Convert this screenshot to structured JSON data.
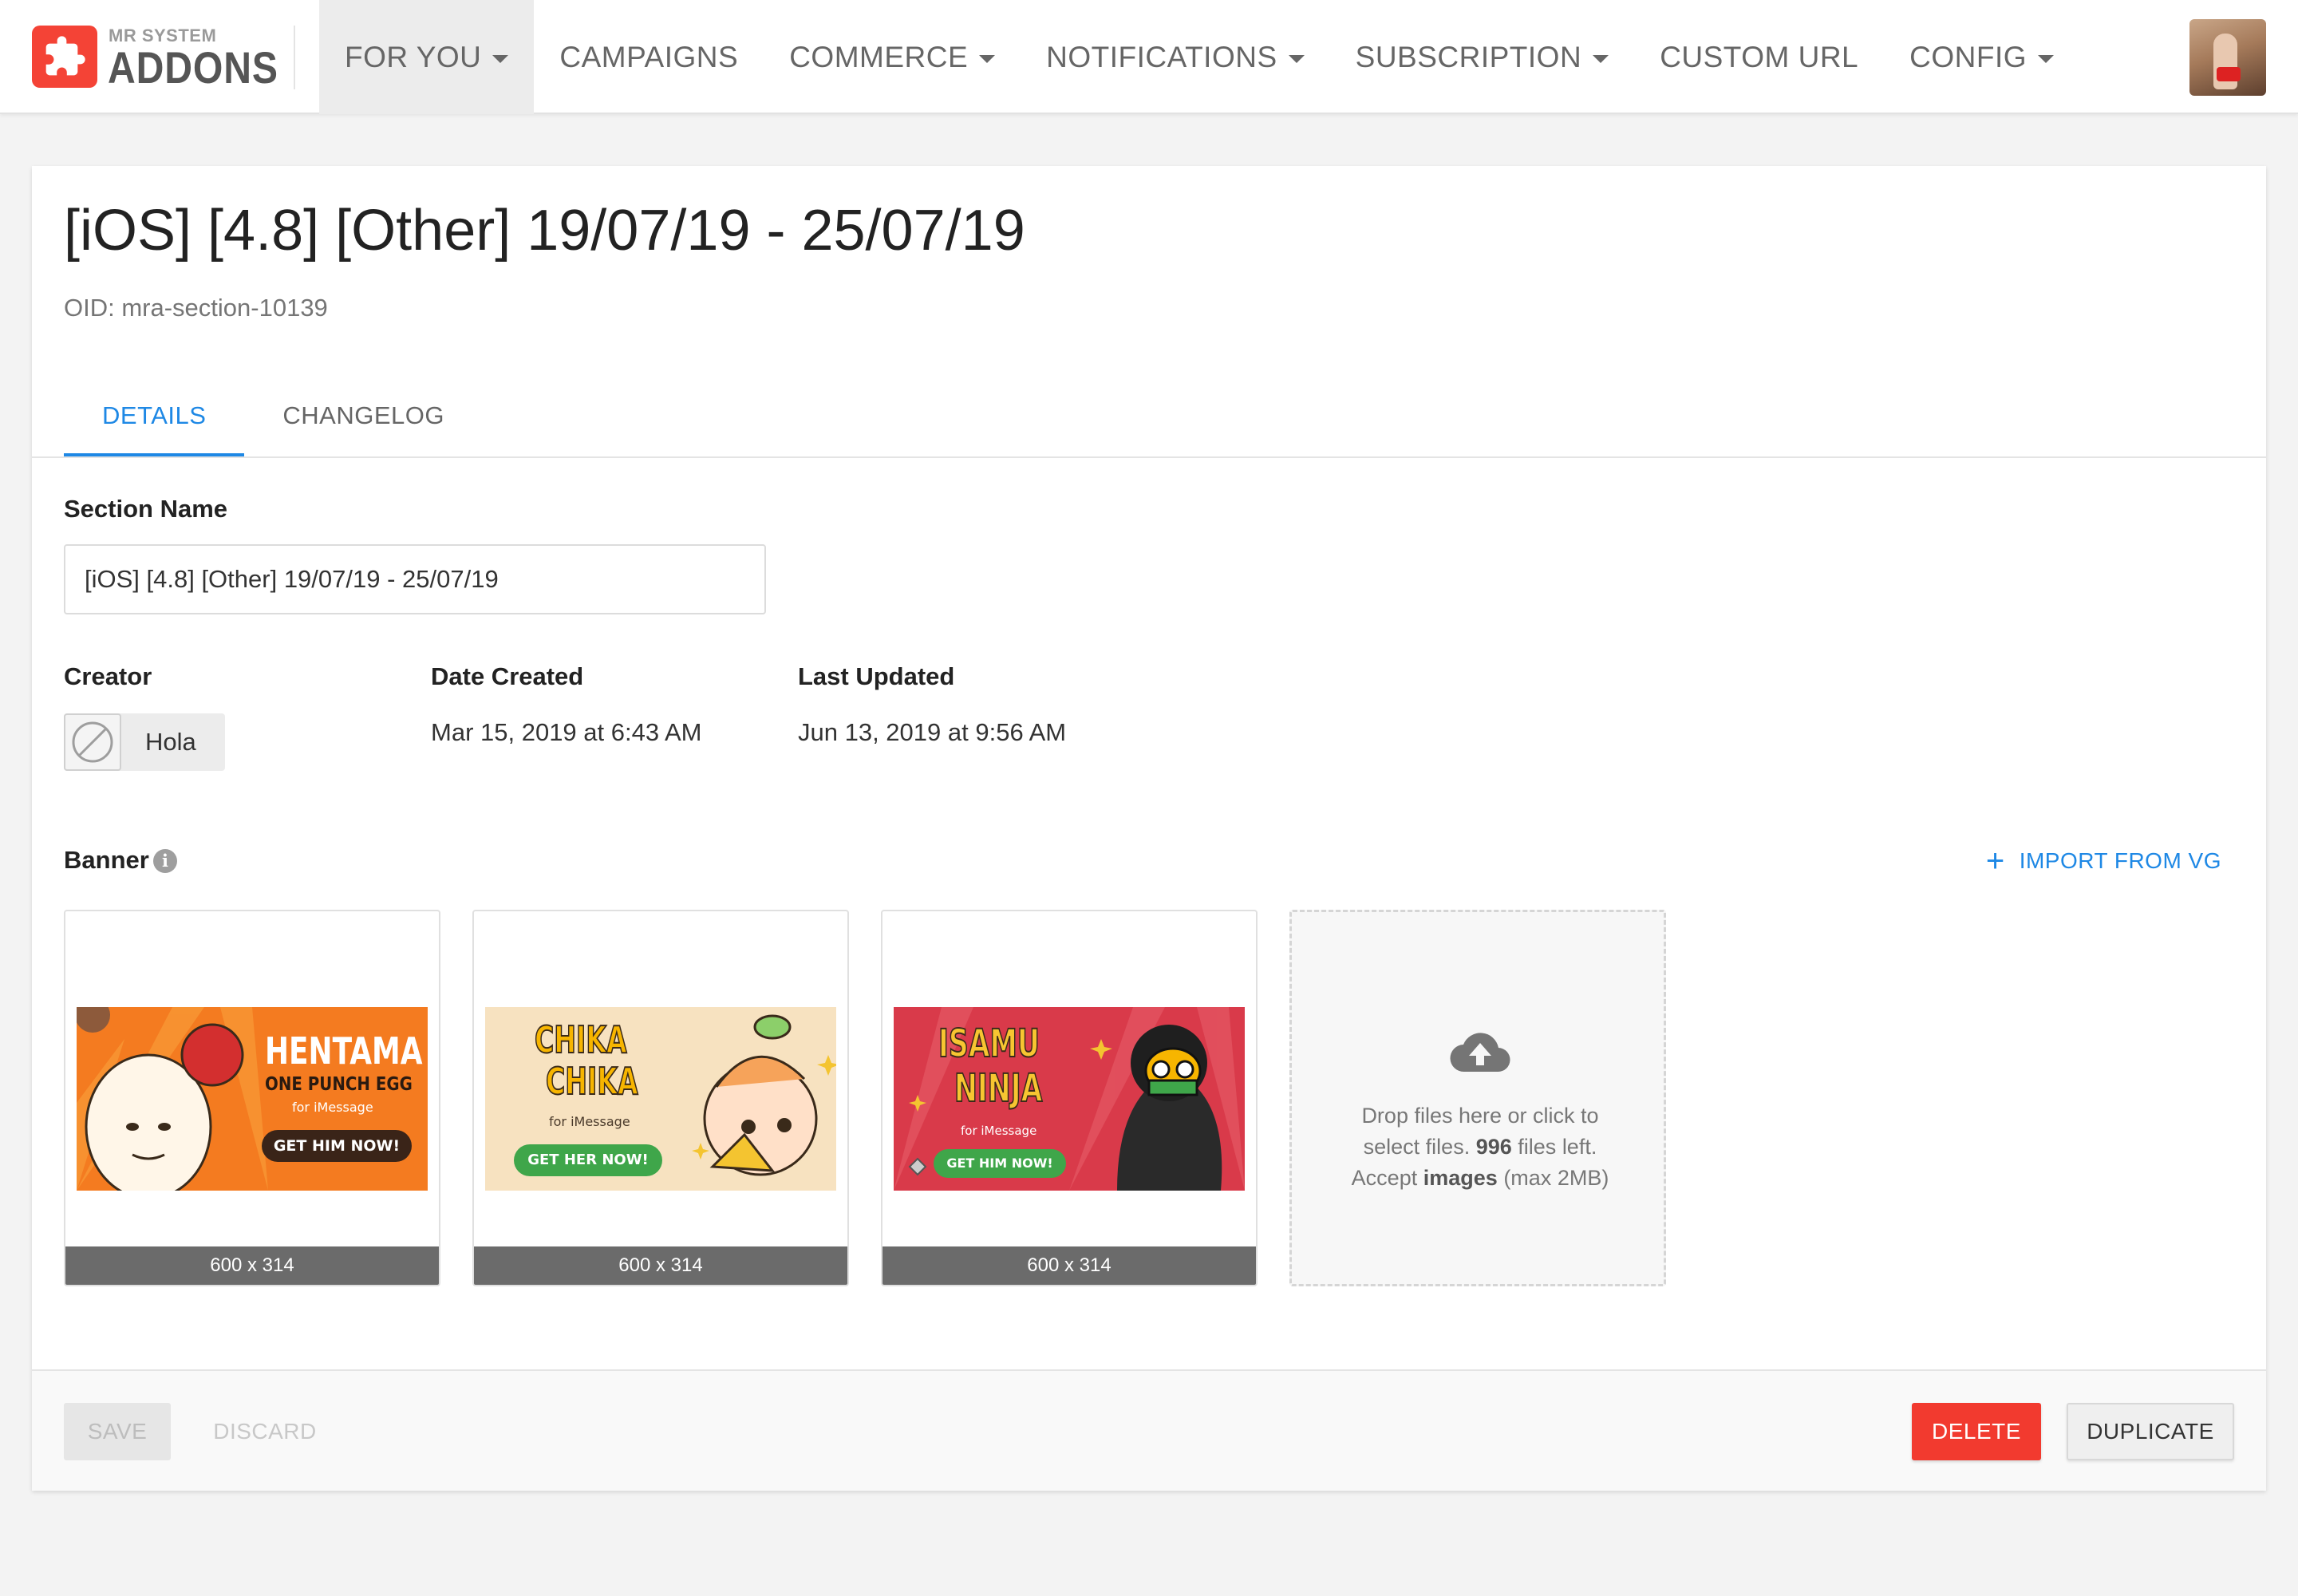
{
  "app": {
    "logo_small": "MR SYSTEM",
    "logo_big": "ADDONS",
    "logo_icon": "puzzle-icon"
  },
  "nav": {
    "items": [
      {
        "label": "FOR YOU",
        "dropdown": true,
        "active": true
      },
      {
        "label": "CAMPAIGNS",
        "dropdown": false
      },
      {
        "label": "COMMERCE",
        "dropdown": true
      },
      {
        "label": "NOTIFICATIONS",
        "dropdown": true
      },
      {
        "label": "SUBSCRIPTION",
        "dropdown": true
      },
      {
        "label": "CUSTOM URL",
        "dropdown": false
      },
      {
        "label": "CONFIG",
        "dropdown": true
      }
    ]
  },
  "page": {
    "title": "[iOS] [4.8] [Other] 19/07/19 - 25/07/19",
    "oid": "OID: mra-section-10139"
  },
  "tabs": [
    {
      "label": "DETAILS",
      "active": true
    },
    {
      "label": "CHANGELOG",
      "active": false
    }
  ],
  "form": {
    "section_name_label": "Section Name",
    "section_name_value": "[iOS] [4.8] [Other] 19/07/19 - 25/07/19",
    "creator_label": "Creator",
    "creator_name": "Hola",
    "date_created_label": "Date Created",
    "date_created_value": "Mar 15, 2019 at 6:43 AM",
    "last_updated_label": "Last Updated",
    "last_updated_value": "Jun 13, 2019 at 9:56 AM",
    "banner_label": "Banner",
    "import_label": "IMPORT FROM VG"
  },
  "banners": [
    {
      "title": "HENTAMA",
      "subtitle": "ONE PUNCH EGG",
      "tagline": "for iMessage",
      "cta": "GET HIM NOW!",
      "size": "600 x 314",
      "bg": "#f47b20"
    },
    {
      "title1": "CHIKA",
      "title2": "CHIKA",
      "tagline": "for iMessage",
      "cta": "GET HER NOW!",
      "size": "600 x 314",
      "bg": "#f7e2c0"
    },
    {
      "title1": "ISAMU",
      "title2": "NINJA",
      "tagline": "for iMessage",
      "cta": "GET HIM NOW!",
      "size": "600 x 314",
      "bg": "#d93a4a"
    }
  ],
  "dropzone": {
    "line1": "Drop files here or click to",
    "line2_pre": "select files.",
    "files_left_count": "996",
    "line2_post": "files left.",
    "line3_pre": "Accept",
    "accept_type": "images",
    "line3_post": "(max 2MB)"
  },
  "footer": {
    "save_label": "SAVE",
    "discard_label": "DISCARD",
    "delete_label": "DELETE",
    "duplicate_label": "DUPLICATE"
  },
  "colors": {
    "accent": "#1e88e5",
    "brand": "#f44336",
    "danger": "#f23a2f"
  }
}
